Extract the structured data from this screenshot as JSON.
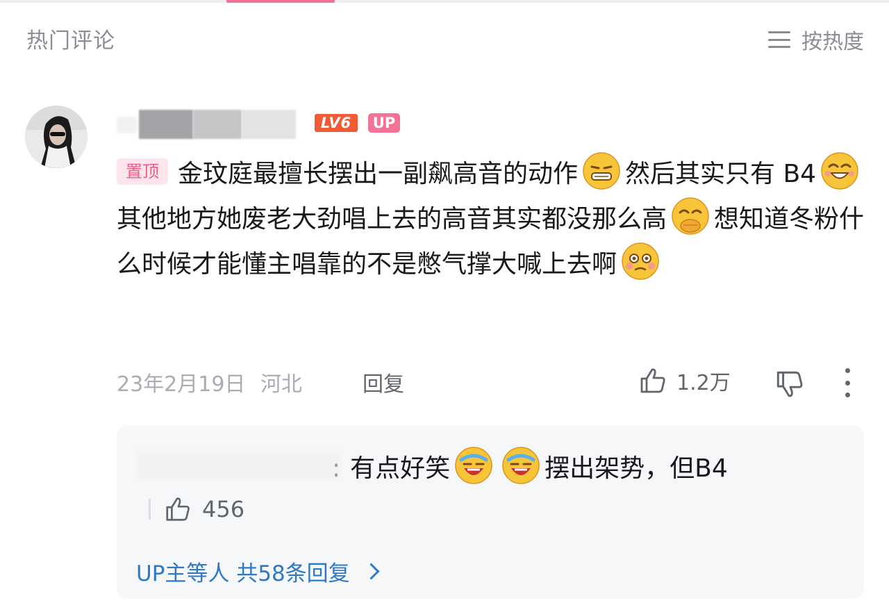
{
  "header": {
    "title": "热门评论",
    "sort_label": "按热度"
  },
  "comment": {
    "level_badge": "LV6",
    "up_badge": "UP",
    "pinned_label": "置顶",
    "segments": [
      "金玟庭最擅长摆出一副飙高音的动作",
      "然后其实只有 B4",
      "其他地方她废老大劲唱上去的高音其实都没那么高",
      "想知道冬粉什么时候才能懂主唱靠的不是憋气撑大喊上去啊"
    ],
    "date": "23年2月19日",
    "location": "河北",
    "reply_label": "回复",
    "likes": "1.2万"
  },
  "reply": {
    "separator": ":",
    "text1": "有点好笑",
    "text2": "摆出架势，但B4",
    "likes": "456",
    "more_label": "UP主等人 共58条回复"
  },
  "colors": {
    "accent": "#f27396",
    "level": "#f05a34",
    "link": "#2e79c6",
    "muted": "#a9acb2"
  }
}
